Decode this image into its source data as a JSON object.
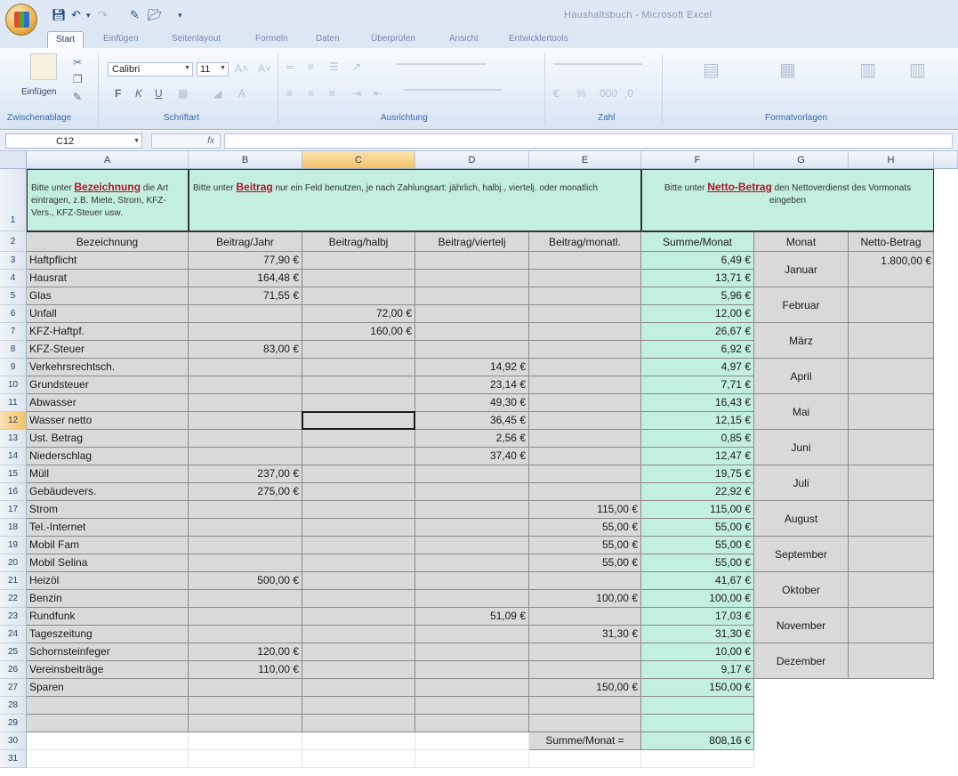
{
  "window": {
    "title": "Haushaltsbuch - Microsoft Excel"
  },
  "tabs": [
    "Start",
    "Einfügen",
    "Seitenlayout",
    "Formeln",
    "Daten",
    "Überprüfen",
    "Ansicht",
    "Entwicklertools"
  ],
  "ribbon": {
    "paste_label": "Einfügen",
    "font_name": "Calibri",
    "font_size": "11",
    "groups": [
      "Zwischenablage",
      "Schriftart",
      "Ausrichtung",
      "Zahl",
      "Formatvorlagen"
    ]
  },
  "formula_bar": {
    "name_box": "C12",
    "fx": "fx",
    "formula": ""
  },
  "columns": [
    "A",
    "B",
    "C",
    "D",
    "E",
    "F",
    "G",
    "H"
  ],
  "selected": {
    "column": "C",
    "row": "12"
  },
  "instructions": {
    "a": {
      "pre": "Bitte unter ",
      "bold": "Bezeichnung",
      "post": " die Art eintragen, z.B. Miete, Strom, KFZ-Vers., KFZ-Steuer usw."
    },
    "b": {
      "pre": "Bitte unter ",
      "bold": "Beitrag",
      "post": " nur ein Feld benutzen, je nach Zahlungsart: jährlich, halbj., viertelj. oder monatlich"
    },
    "f": {
      "pre": "Bitte unter ",
      "bold": "Netto-Betrag",
      "post": " den Nettoverdienst des Vormonats eingeben"
    }
  },
  "headers": {
    "bezeichnung": "Bezeichnung",
    "jahr": "Beitrag/Jahr",
    "halbj": "Beitrag/halbj",
    "viertelj": "Beitrag/viertelj",
    "monatl": "Beitrag/monatl.",
    "summe": "Summe/Monat",
    "monat": "Monat",
    "netto": "Netto-Betrag"
  },
  "rows": [
    {
      "n": "3",
      "name": "Haftpflicht",
      "jahr": "77,90 €",
      "halbj": "",
      "viertelj": "",
      "monatl": "",
      "summe": "6,49 €"
    },
    {
      "n": "4",
      "name": "Hausrat",
      "jahr": "164,48 €",
      "halbj": "",
      "viertelj": "",
      "monatl": "",
      "summe": "13,71 €"
    },
    {
      "n": "5",
      "name": "Glas",
      "jahr": "71,55 €",
      "halbj": "",
      "viertelj": "",
      "monatl": "",
      "summe": "5,96 €"
    },
    {
      "n": "6",
      "name": "Unfall",
      "jahr": "",
      "halbj": "72,00 €",
      "viertelj": "",
      "monatl": "",
      "summe": "12,00 €"
    },
    {
      "n": "7",
      "name": "KFZ-Haftpf.",
      "jahr": "",
      "halbj": "160,00 €",
      "viertelj": "",
      "monatl": "",
      "summe": "26,67 €"
    },
    {
      "n": "8",
      "name": "KFZ-Steuer",
      "jahr": "83,00 €",
      "halbj": "",
      "viertelj": "",
      "monatl": "",
      "summe": "6,92 €"
    },
    {
      "n": "9",
      "name": "Verkehrsrechtsch.",
      "jahr": "",
      "halbj": "",
      "viertelj": "14,92 €",
      "monatl": "",
      "summe": "4,97 €"
    },
    {
      "n": "10",
      "name": "Grundsteuer",
      "jahr": "",
      "halbj": "",
      "viertelj": "23,14 €",
      "monatl": "",
      "summe": "7,71 €"
    },
    {
      "n": "11",
      "name": "Abwasser",
      "jahr": "",
      "halbj": "",
      "viertelj": "49,30 €",
      "monatl": "",
      "summe": "16,43 €"
    },
    {
      "n": "12",
      "name": "Wasser netto",
      "jahr": "",
      "halbj": "",
      "viertelj": "36,45 €",
      "monatl": "",
      "summe": "12,15 €"
    },
    {
      "n": "13",
      "name": "Ust. Betrag",
      "jahr": "",
      "halbj": "",
      "viertelj": "2,56 €",
      "monatl": "",
      "summe": "0,85 €"
    },
    {
      "n": "14",
      "name": "Niederschlag",
      "jahr": "",
      "halbj": "",
      "viertelj": "37,40 €",
      "monatl": "",
      "summe": "12,47 €"
    },
    {
      "n": "15",
      "name": "Müll",
      "jahr": "237,00 €",
      "halbj": "",
      "viertelj": "",
      "monatl": "",
      "summe": "19,75 €"
    },
    {
      "n": "16",
      "name": "Gebäudevers.",
      "jahr": "275,00 €",
      "halbj": "",
      "viertelj": "",
      "monatl": "",
      "summe": "22,92 €"
    },
    {
      "n": "17",
      "name": "Strom",
      "jahr": "",
      "halbj": "",
      "viertelj": "",
      "monatl": "115,00 €",
      "summe": "115,00 €"
    },
    {
      "n": "18",
      "name": "Tel.-Internet",
      "jahr": "",
      "halbj": "",
      "viertelj": "",
      "monatl": "55,00 €",
      "summe": "55,00 €"
    },
    {
      "n": "19",
      "name": "Mobil Fam",
      "jahr": "",
      "halbj": "",
      "viertelj": "",
      "monatl": "55,00 €",
      "summe": "55,00 €"
    },
    {
      "n": "20",
      "name": "Mobil Selina",
      "jahr": "",
      "halbj": "",
      "viertelj": "",
      "monatl": "55,00 €",
      "summe": "55,00 €"
    },
    {
      "n": "21",
      "name": "Heizöl",
      "jahr": "500,00 €",
      "halbj": "",
      "viertelj": "",
      "monatl": "",
      "summe": "41,67 €"
    },
    {
      "n": "22",
      "name": "Benzin",
      "jahr": "",
      "halbj": "",
      "viertelj": "",
      "monatl": "100,00 €",
      "summe": "100,00 €"
    },
    {
      "n": "23",
      "name": "Rundfunk",
      "jahr": "",
      "halbj": "",
      "viertelj": "51,09 €",
      "monatl": "",
      "summe": "17,03 €"
    },
    {
      "n": "24",
      "name": "Tageszeitung",
      "jahr": "",
      "halbj": "",
      "viertelj": "",
      "monatl": "31,30 €",
      "summe": "31,30 €"
    },
    {
      "n": "25",
      "name": "Schornsteinfeger",
      "jahr": "120,00 €",
      "halbj": "",
      "viertelj": "",
      "monatl": "",
      "summe": "10,00 €"
    },
    {
      "n": "26",
      "name": "Vereinsbeiträge",
      "jahr": "110,00 €",
      "halbj": "",
      "viertelj": "",
      "monatl": "",
      "summe": "9,17 €"
    },
    {
      "n": "27",
      "name": "Sparen",
      "jahr": "",
      "halbj": "",
      "viertelj": "",
      "monatl": "150,00 €",
      "summe": "150,00 €"
    },
    {
      "n": "28",
      "name": "",
      "jahr": "",
      "halbj": "",
      "viertelj": "",
      "monatl": "",
      "summe": ""
    },
    {
      "n": "29",
      "name": "",
      "jahr": "",
      "halbj": "",
      "viertelj": "",
      "monatl": "",
      "summe": ""
    }
  ],
  "total": {
    "label": "Summe/Monat =",
    "value": "808,16 €"
  },
  "months": [
    "Januar",
    "Februar",
    "März",
    "April",
    "Mai",
    "Juni",
    "Juli",
    "August",
    "September",
    "Oktober",
    "November",
    "Dezember"
  ],
  "netto_values": [
    "1.800,00 €",
    "",
    "",
    "",
    "",
    "",
    "",
    "",
    "",
    "",
    "",
    ""
  ],
  "extra_rows": [
    "30",
    "31"
  ],
  "row_labels": {
    "r1": "1",
    "r2": "2"
  }
}
